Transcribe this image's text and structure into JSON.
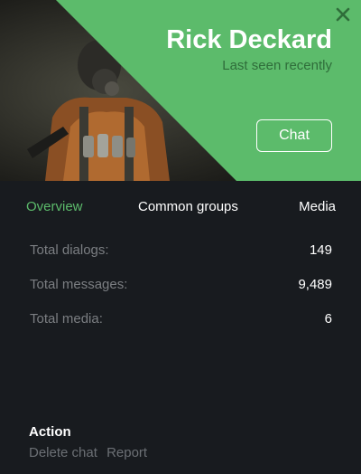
{
  "profile": {
    "name": "Rick Deckard",
    "status": "Last seen recently",
    "chat_label": "Chat"
  },
  "icons": {
    "close": "close-icon",
    "photo": "profile-photo"
  },
  "colors": {
    "accent": "#5cbb6b",
    "background": "#181b1f",
    "muted_text": "#7b7e82"
  },
  "tabs": [
    {
      "label": "Overview",
      "active": true
    },
    {
      "label": "Common groups",
      "active": false
    },
    {
      "label": "Media",
      "active": false
    }
  ],
  "stats": [
    {
      "label": "Total dialogs:",
      "value": "149"
    },
    {
      "label": "Total messages:",
      "value": "9,489"
    },
    {
      "label": "Total media:",
      "value": "6"
    }
  ],
  "action": {
    "title": "Action",
    "links": [
      "Delete chat",
      "Report"
    ]
  }
}
